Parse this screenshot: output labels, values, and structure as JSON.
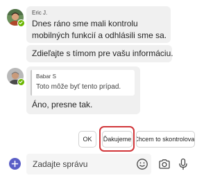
{
  "messages": [
    {
      "sender": "Eric J.",
      "lines": [
        "Dnes ráno sme mali kontrolu",
        "mobilných funkcií a odhlásili sme sa."
      ]
    },
    {
      "lines": [
        "Zdieľajte s tímom pre vašu informáciu."
      ]
    },
    {
      "sender": "Babar S",
      "quote": {
        "sender": "Babar S",
        "text": "Toto môže byť tento prípad."
      },
      "lines": [
        "Áno, presne tak."
      ]
    }
  ],
  "suggested_replies": [
    {
      "label": "OK"
    },
    {
      "label": "Ďakujeme",
      "highlighted": true
    },
    {
      "label": "Chcem to skontrolovať"
    }
  ],
  "composer": {
    "placeholder": "Zadajte správu",
    "icons": [
      "add-icon",
      "emoji-icon",
      "camera-icon",
      "microphone-icon"
    ]
  },
  "colors": {
    "bubble": "#f0f0f0",
    "accent": "#5b5fc7",
    "presence": "#6bb700",
    "highlight": "#d13438"
  }
}
